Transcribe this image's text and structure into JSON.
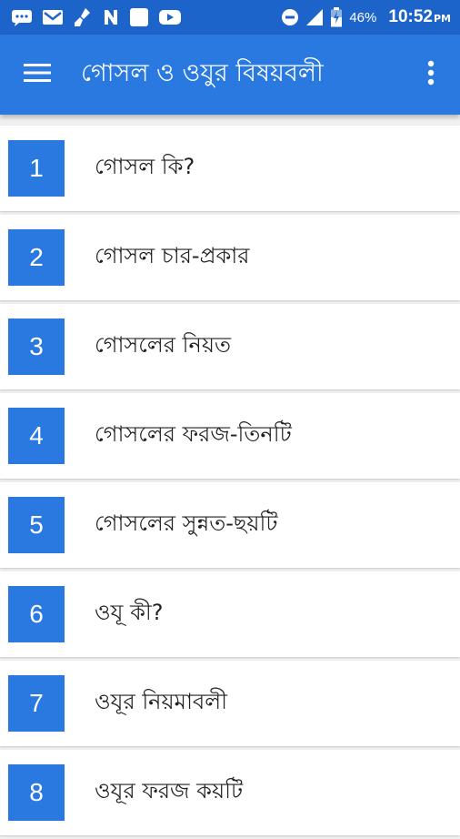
{
  "status_bar": {
    "battery": "46%",
    "time": "10:52",
    "ampm": "PM",
    "icons": [
      "messages-icon",
      "gmail-icon",
      "cleaner-icon",
      "n-icon",
      "blank-app-icon",
      "youtube-icon",
      "do-not-disturb-icon",
      "signal-icon",
      "battery-icon"
    ]
  },
  "app_bar": {
    "title": "গোসল ও ওযুর বিষয়বলী",
    "menu_icon": "hamburger-menu-icon",
    "more_icon": "more-vert-icon"
  },
  "colors": {
    "status_bar": "#1c64c9",
    "primary": "#2a79e0",
    "background": "#f1f1f1",
    "row": "#ffffff"
  },
  "items": [
    {
      "number": "1",
      "label": "গোসল কি?"
    },
    {
      "number": "2",
      "label": "গোসল চার-প্রকার"
    },
    {
      "number": "3",
      "label": "গোসলের নিয়ত"
    },
    {
      "number": "4",
      "label": "গোসলের ফরজ-তিনটি"
    },
    {
      "number": "5",
      "label": "গোসলের সুন্নত-ছয়টি"
    },
    {
      "number": "6",
      "label": "ওযূ কী?"
    },
    {
      "number": "7",
      "label": "ওযূর নিয়মাবলী"
    },
    {
      "number": "8",
      "label": "ওযূর ফরজ কয়টি"
    }
  ]
}
